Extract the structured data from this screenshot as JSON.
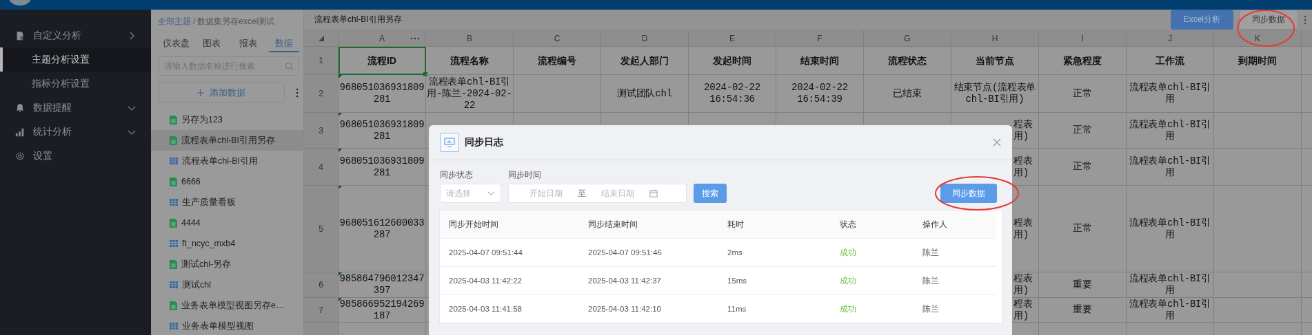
{
  "sidebar": {
    "items": [
      {
        "label": "自定义分析",
        "expanded": true,
        "children": [
          {
            "label": "主题分析设置",
            "selected": true
          },
          {
            "label": "指标分析设置",
            "selected": false
          }
        ]
      },
      {
        "label": "数据提醒",
        "expanded": false
      },
      {
        "label": "统计分析",
        "expanded": false
      },
      {
        "label": "设置"
      }
    ]
  },
  "data_panel": {
    "breadcrumb": {
      "link": "全部主题",
      "separator": "/",
      "current": "数据集另存excel测试"
    },
    "tabs": [
      {
        "label": "仪表盘",
        "selected": false
      },
      {
        "label": "图表",
        "selected": false
      },
      {
        "label": "报表",
        "selected": false
      },
      {
        "label": "数据",
        "selected": true
      }
    ],
    "search": {
      "placeholder": "请输入数据名称进行搜索"
    },
    "add_button": "添加数据",
    "items": [
      {
        "label": "另存为123",
        "kind": "sheet",
        "selected": false
      },
      {
        "label": "流程表单chl-BI引用另存",
        "kind": "sheet",
        "selected": true
      },
      {
        "label": "流程表单chl-BI引用",
        "kind": "table",
        "selected": false
      },
      {
        "label": "6666",
        "kind": "sheet",
        "selected": false
      },
      {
        "label": "生产质量看板",
        "kind": "table",
        "selected": false
      },
      {
        "label": "4444",
        "kind": "sheet",
        "selected": false
      },
      {
        "label": "ft_ncyc_mxb4",
        "kind": "table",
        "selected": false
      },
      {
        "label": "测试chl-另存",
        "kind": "sheet",
        "selected": false
      },
      {
        "label": "测试chl",
        "kind": "table",
        "selected": false
      },
      {
        "label": "业务表单模型视图另存e…",
        "kind": "sheet",
        "selected": false
      },
      {
        "label": "业务表单模型视图",
        "kind": "table",
        "selected": false
      }
    ]
  },
  "main": {
    "title": "流程表单chl-BI引用另存",
    "buttons": [
      {
        "label": "Excel分析",
        "kind": "primary"
      },
      {
        "label": "同步数据",
        "kind": "default"
      }
    ],
    "grid": {
      "columns": [
        "A",
        "B",
        "C",
        "D",
        "E",
        "F",
        "G",
        "H",
        "I",
        "J",
        "K"
      ],
      "rows": [
        {
          "number": "1",
          "kind": "header",
          "selected": true,
          "marked": false,
          "cells": {
            "A": "流程ID",
            "B": "流程名称",
            "C": "流程编号",
            "D": "发起人部门",
            "E": "发起时间",
            "F": "结束时间",
            "G": "流程状态",
            "H": "当前节点",
            "I": "紧急程度",
            "J": "工作流",
            "K": "到期时间"
          }
        },
        {
          "number": "2",
          "kind": "data",
          "selected": false,
          "marked": true,
          "cells": {
            "A": "968051036931809281",
            "B": "流程表单chl-BI引用-陈兰-2024-02-22",
            "D": "测试团队chl",
            "E": "2024-02-22 16:54:36",
            "F": "2024-02-22 16:54:39",
            "G": "已结束",
            "H": "结束节点(流程表单chl-BI引用)",
            "I": "正常",
            "J": "流程表单chl-BI引用"
          }
        },
        {
          "number": "3",
          "kind": "data",
          "selected": false,
          "marked": true,
          "cells": {
            "A": "968051036931809281",
            "H": "程表用)",
            "I": "正常",
            "J": "流程表单chl-BI引用"
          }
        },
        {
          "number": "4",
          "kind": "data",
          "selected": false,
          "marked": true,
          "cells": {
            "A": "968051036931809281",
            "H": "程表用)",
            "I": "正常",
            "J": "流程表单chl-BI引用"
          }
        },
        {
          "number": "5",
          "kind": "data",
          "selected": false,
          "marked": true,
          "cells": {
            "A": "968051612600033287",
            "H": "程表用)",
            "I": "正常",
            "J": "流程表单chl-BI引用"
          }
        },
        {
          "number": "6",
          "kind": "data",
          "selected": false,
          "marked": true,
          "cells": {
            "A": "985864796012347397",
            "H": "程表用)",
            "I": "重要",
            "J": "流程表单chl-BI引用"
          }
        },
        {
          "number": "7",
          "kind": "data",
          "selected": false,
          "marked": true,
          "cells": {
            "A": "985866952194269187",
            "H": "程表用)",
            "I": "重要",
            "J": "流程表单chl-BI引用"
          }
        }
      ]
    }
  },
  "dialog": {
    "title": "同步日志",
    "filters": [
      {
        "label": "同步状态",
        "kind": "select",
        "placeholder": "请选择"
      },
      {
        "label": "同步时间",
        "kind": "daterange",
        "start_placeholder": "开始日期",
        "separator": "至",
        "end_placeholder": "结束日期"
      }
    ],
    "search_button": "搜索",
    "sync_button": "同步数据",
    "columns": [
      "同步开始时间",
      "同步结束时间",
      "耗时",
      "状态",
      "操作人"
    ],
    "rows": [
      {
        "start": "2025-04-07 09:51:44",
        "end": "2025-04-07 09:51:46",
        "duration": "2ms",
        "status": "成功",
        "color": "#67c23a",
        "operator": "陈兰"
      },
      {
        "start": "2025-04-03 11:42:22",
        "end": "2025-04-03 11:42:37",
        "duration": "15ms",
        "status": "成功",
        "color": "#67c23a",
        "operator": "陈兰"
      },
      {
        "start": "2025-04-03 11:41:58",
        "end": "2025-04-03 11:42:10",
        "duration": "11ms",
        "status": "成功",
        "color": "#67c23a",
        "operator": "陈兰"
      }
    ]
  }
}
